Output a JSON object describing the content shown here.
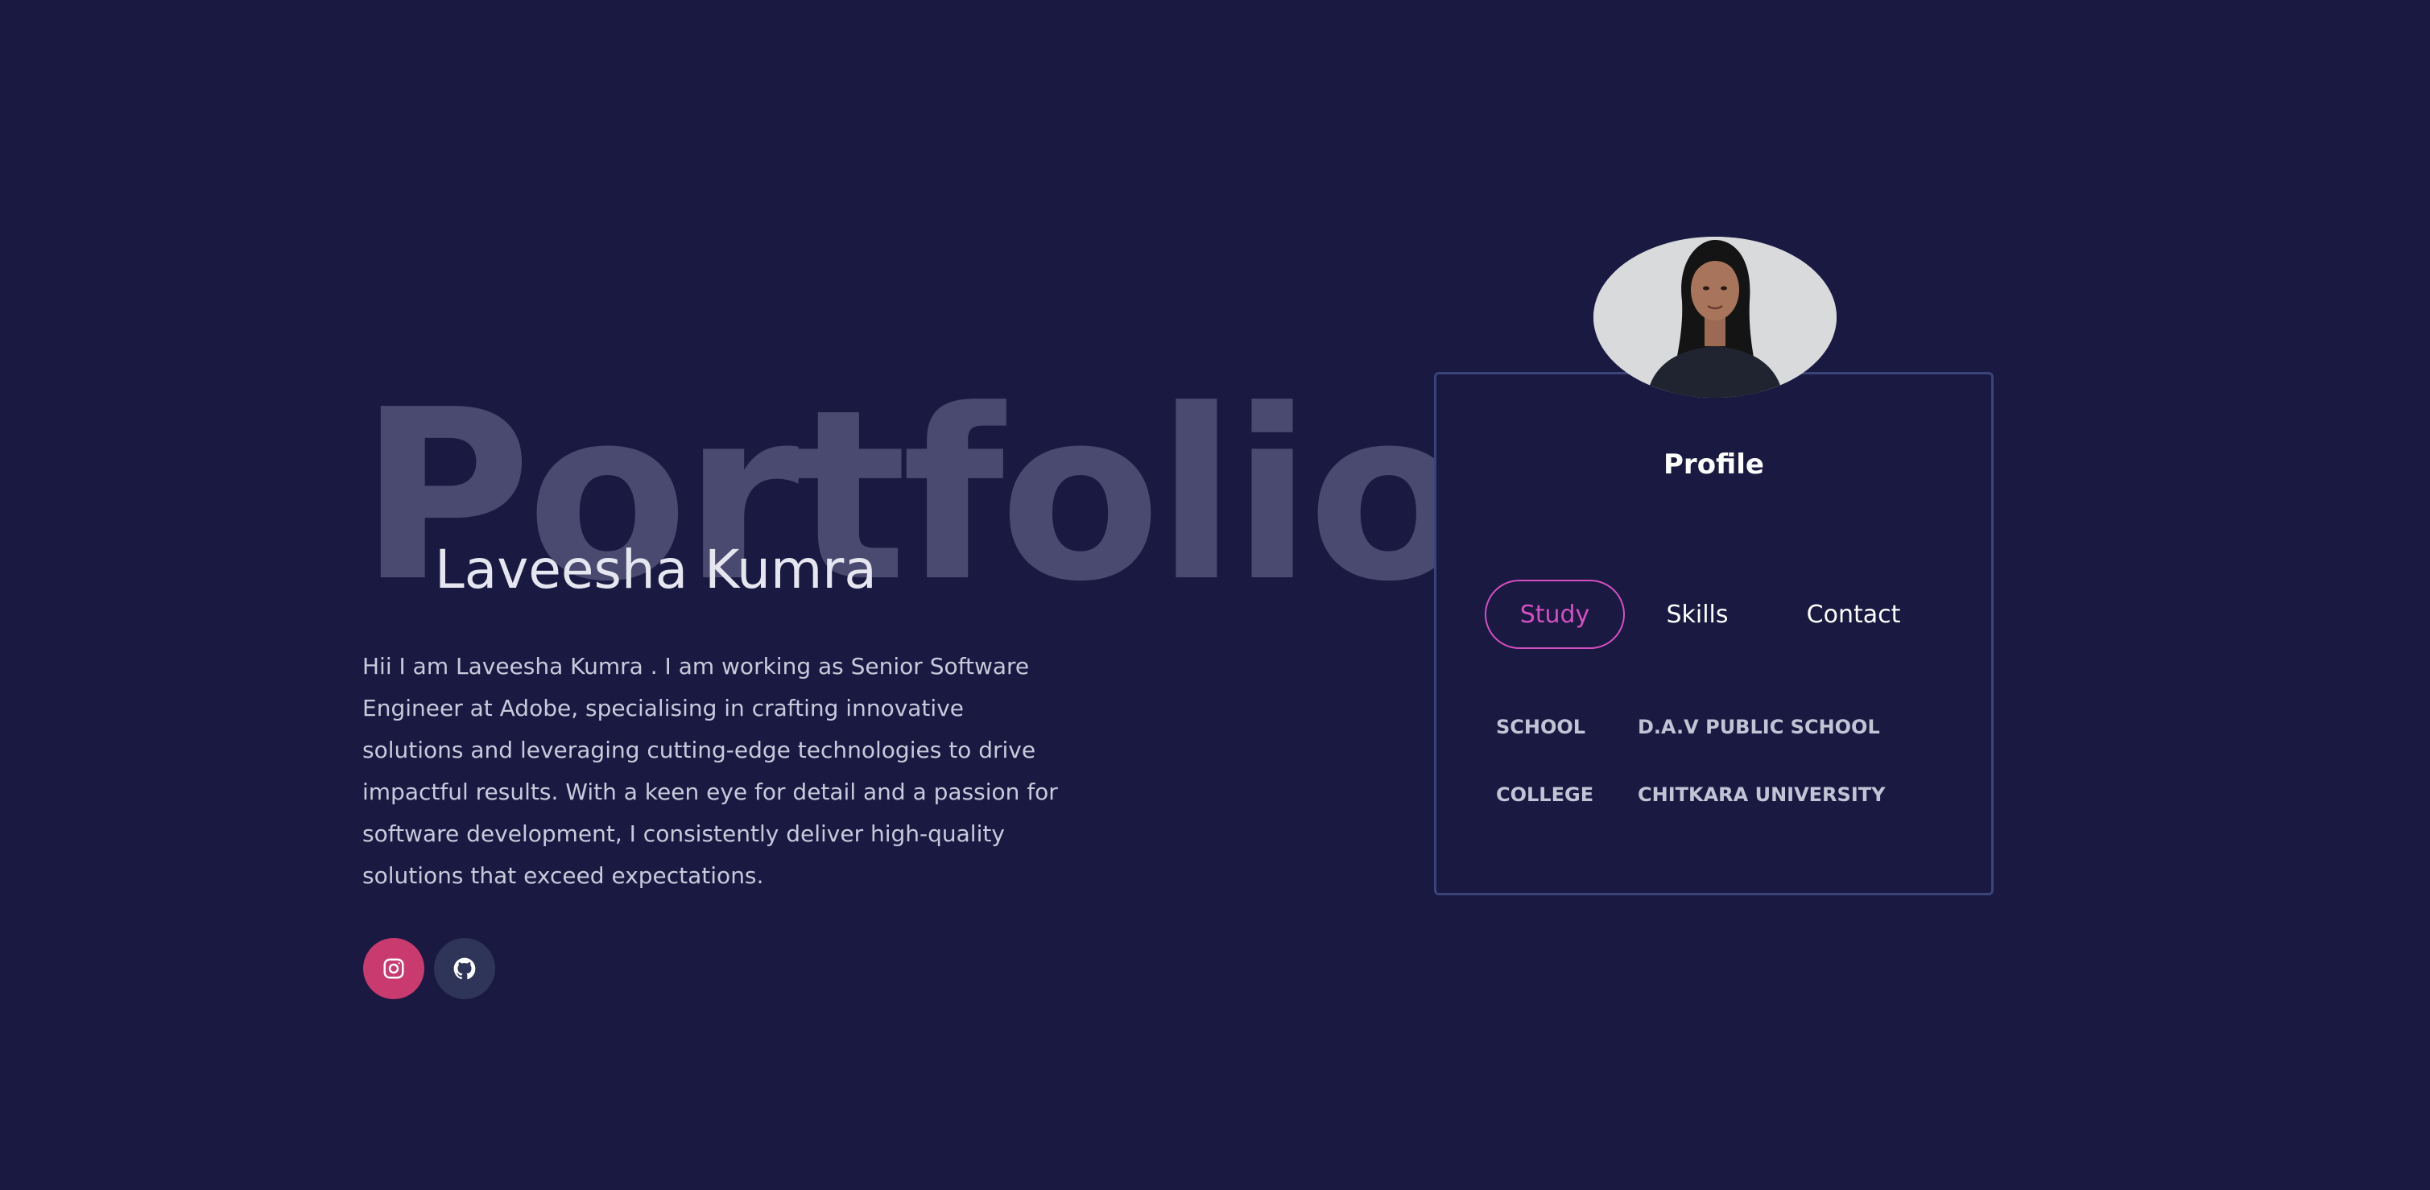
{
  "hero": {
    "background_word": "Portfolio",
    "name": "Laveesha Kumra",
    "bio": "Hii I am Laveesha Kumra . I am working as Senior Software Engineer at Adobe, specialising in crafting innovative solutions and leveraging cutting-edge technologies to drive impactful results. With a keen eye for detail and a passion for software development, I consistently deliver high-quality solutions that exceed expectations."
  },
  "socials": [
    {
      "name": "instagram",
      "icon": "instagram-icon",
      "color": "#c93a6f"
    },
    {
      "name": "github",
      "icon": "github-icon",
      "color": "#2e3558"
    }
  ],
  "profile": {
    "title": "Profile",
    "tabs": [
      {
        "label": "Study",
        "active": true
      },
      {
        "label": "Skills",
        "active": false
      },
      {
        "label": "Contact",
        "active": false
      }
    ],
    "study": [
      {
        "key": "SCHOOL",
        "value": "D.A.V PUBLIC SCHOOL"
      },
      {
        "key": "COLLEGE",
        "value": "CHITKARA UNIVERSITY"
      }
    ]
  },
  "colors": {
    "background": "#191942",
    "accent": "#d64fc0",
    "card_border": "#3a4478",
    "background_word": "#4a4a70"
  }
}
